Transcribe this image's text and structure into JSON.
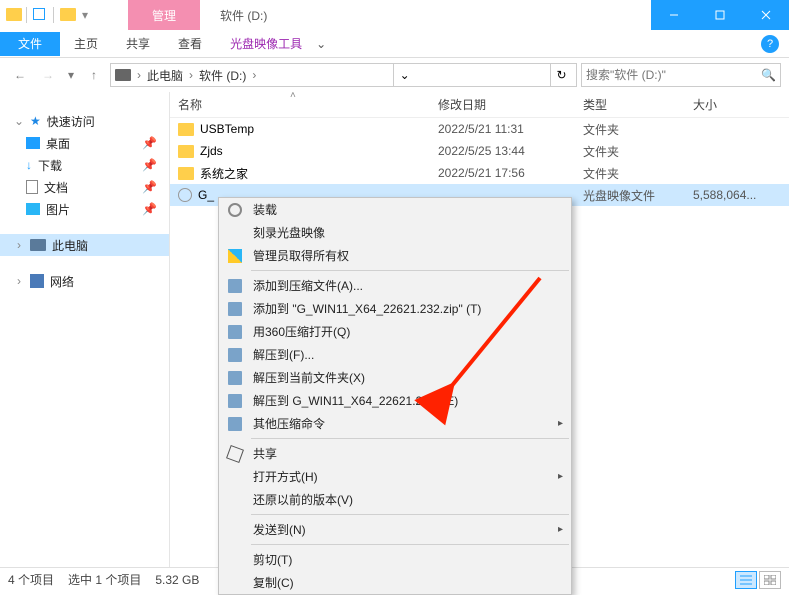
{
  "title_bar": {
    "context_tab": "管理",
    "app_title": "软件 (D:)"
  },
  "ribbon": {
    "file": "文件",
    "tabs": [
      "主页",
      "共享",
      "查看"
    ],
    "tool_tab": "光盘映像工具"
  },
  "address": {
    "crumbs": [
      "此电脑",
      "软件 (D:)"
    ],
    "search_placeholder": "搜索\"软件 (D:)\""
  },
  "sidebar": {
    "quick": "快速访问",
    "quick_items": [
      "桌面",
      "下载",
      "文档",
      "图片"
    ],
    "this_pc": "此电脑",
    "network": "网络"
  },
  "columns": {
    "name": "名称",
    "date": "修改日期",
    "type": "类型",
    "size": "大小"
  },
  "rows": [
    {
      "name": "USBTemp",
      "date": "2022/5/21 11:31",
      "type": "文件夹",
      "size": "",
      "icon": "folder"
    },
    {
      "name": "Zjds",
      "date": "2022/5/25 13:44",
      "type": "文件夹",
      "size": "",
      "icon": "folder"
    },
    {
      "name": "系统之家",
      "date": "2022/5/21 17:56",
      "type": "文件夹",
      "size": "",
      "icon": "folder"
    },
    {
      "name": "G_",
      "date": "",
      "type": "光盘映像文件",
      "size": "5,588,064...",
      "icon": "iso",
      "selected": true
    }
  ],
  "context_menu": {
    "items": [
      {
        "label": "装载",
        "icon": "disk"
      },
      {
        "label": "刻录光盘映像"
      },
      {
        "label": "管理员取得所有权",
        "icon": "shield"
      },
      {
        "sep": true
      },
      {
        "label": "添加到压缩文件(A)...",
        "icon": "box"
      },
      {
        "label": "添加到 \"G_WIN11_X64_22621.232.zip\" (T)",
        "icon": "box"
      },
      {
        "label": "用360压缩打开(Q)",
        "icon": "box"
      },
      {
        "label": "解压到(F)...",
        "icon": "box"
      },
      {
        "label": "解压到当前文件夹(X)",
        "icon": "box"
      },
      {
        "label": "解压到 G_WIN11_X64_22621.232\\ (E)",
        "icon": "box"
      },
      {
        "label": "其他压缩命令",
        "icon": "box",
        "sub": true
      },
      {
        "sep": true
      },
      {
        "label": "共享",
        "icon": "share"
      },
      {
        "label": "打开方式(H)",
        "sub": true
      },
      {
        "label": "还原以前的版本(V)"
      },
      {
        "sep": true
      },
      {
        "label": "发送到(N)",
        "sub": true
      },
      {
        "sep": true
      },
      {
        "label": "剪切(T)"
      },
      {
        "label": "复制(C)"
      }
    ]
  },
  "status": {
    "count": "4 个项目",
    "selection": "选中 1 个项目",
    "size": "5.32 GB"
  }
}
